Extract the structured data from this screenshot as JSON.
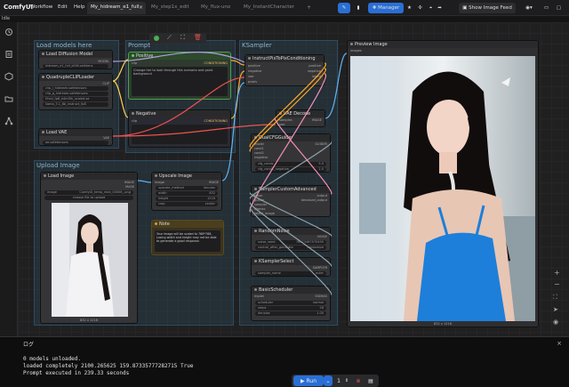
{
  "app": {
    "name": "ComfyUI",
    "sub_label": "Idle"
  },
  "menu": [
    "Workflow",
    "Edit",
    "Help"
  ],
  "tabs": [
    {
      "label": "My_hidream_e1_full",
      "active": true
    },
    {
      "label": "My_step1x_edit",
      "active": false
    },
    {
      "label": "My_flux-uno",
      "active": false
    },
    {
      "label": "My_InstantCharacter",
      "active": false
    }
  ],
  "toolbar": {
    "manager_label": "Manager",
    "show_feed_label": "Show Image Feed",
    "accent": "#2a6fd6"
  },
  "groups": {
    "load_models": "Load models here",
    "prompt": "Prompt",
    "sampler": "KSampler",
    "upload": "Upload Image"
  },
  "nodes": {
    "unet": {
      "title": "Load Diffusion Model",
      "unet_name": "hidream_e1_full_bf16.safetens",
      "weight_dtype": "default",
      "out": "MODEL"
    },
    "clip": {
      "title": "QuadrupleCLIPLoader",
      "c1": "clip_l_hidream.safetensors",
      "c2": "clip_g_hidream.safetensors",
      "c3": "t5xxl_fp8_e4m3fn_scaled.sa",
      "c4": "llama_3.1_8b_instruct_fp8",
      "out": "CLIP"
    },
    "vae": {
      "title": "Load VAE",
      "vae_name": "ae.safetensors",
      "out": "VAE"
    },
    "positive": {
      "title": "Positive",
      "text": "Change her to look through this scenario and paint background",
      "out": "CONDITIONING",
      "in": "clip"
    },
    "negative": {
      "title": "Negative",
      "out": "CONDITIONING",
      "in": "clip"
    },
    "ip2p": {
      "title": "InstructPixToPixConditioning",
      "ins": [
        "positive",
        "negative",
        "vae",
        "pixels"
      ],
      "outs": [
        "positive",
        "negative",
        "latent"
      ]
    },
    "vaedecode": {
      "title": "VAE Decode",
      "ins": [
        "samples",
        "vae"
      ],
      "out": "IMAGE"
    },
    "guider": {
      "title": "DualCFGGuider",
      "ins": [
        "model",
        "cond1",
        "cond2",
        "negative"
      ],
      "out": "GUIDER",
      "w1": "cfg_conds",
      "w1v": "5.0",
      "w2": "cfg_cond2_negative",
      "w2v": "2.0"
    },
    "scustom": {
      "title": "SamplerCustomAdvanced",
      "ins": [
        "noise",
        "guider",
        "sampler",
        "sigmas",
        "latent_image"
      ],
      "outs": [
        "output",
        "denoised_output"
      ]
    },
    "noise": {
      "title": "RandomNoise",
      "out": "NOISE",
      "seed_label": "noise_seed",
      "seed": "76473467570495",
      "cag_label": "control_after_generate",
      "cag": "randomize"
    },
    "ksel": {
      "title": "KSamplerSelect",
      "out": "SAMPLER",
      "sampler_label": "sampler_name",
      "sampler": "euler"
    },
    "sched": {
      "title": "BasicScheduler",
      "in": "model",
      "out": "SIGMAS",
      "s1": "scheduler",
      "s1v": "normal",
      "s2": "steps",
      "s2v": "28",
      "s3": "denoise",
      "s3v": "1.00"
    },
    "loadimg": {
      "title": "Load Image",
      "out1": "IMAGE",
      "out2": "MASK",
      "image_label": "image",
      "image": "ComfyUI_temp_rdxk_00006_.png",
      "upload": "choose file to upload",
      "size": "832 x 1216"
    },
    "upscale": {
      "title": "Upscale Image",
      "in": "image",
      "out": "IMAGE",
      "w1": "upscale_method",
      "w1v": "lanczos",
      "w2": "width",
      "w2v": "832",
      "w3": "height",
      "w3v": "1216",
      "w4": "crop",
      "w4v": "center"
    },
    "note": {
      "title": "Note",
      "text": "Your image will be scaled to 768*768, Losing width and height may not be able to generate a good response."
    },
    "preview": {
      "title": "Preview Image",
      "in": "images",
      "size": "832 x 1216"
    }
  },
  "log": {
    "title": "ログ",
    "lines": [
      "0 models unloaded.",
      "loaded completely 2100.265625 159.87335777282715 True",
      "Prompt executed in 239.33 seconds"
    ]
  },
  "run": {
    "label": "Run",
    "count": "1"
  }
}
